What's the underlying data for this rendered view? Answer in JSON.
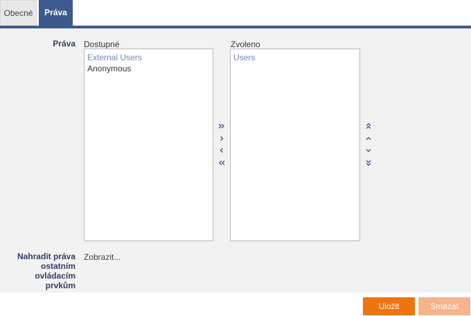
{
  "tabs": [
    {
      "label": "Obecné",
      "active": false
    },
    {
      "label": "Práva",
      "active": true
    }
  ],
  "rights": {
    "label": "Práva",
    "available_title": "Dostupné",
    "selected_title": "Zvoleno",
    "available_items": [
      "External Users",
      "Anonymous"
    ],
    "selected_items": [
      "Users"
    ]
  },
  "replace": {
    "label": "Nahradit práva ostatním ovládacím prvkům",
    "link": "Zobrazit..."
  },
  "actions": {
    "save_label": "Uložit",
    "delete_label": "Smazat"
  },
  "colors": {
    "accent": "#3d5a8c",
    "primary_button": "#f07312",
    "disabled_button": "#f6b48a"
  }
}
